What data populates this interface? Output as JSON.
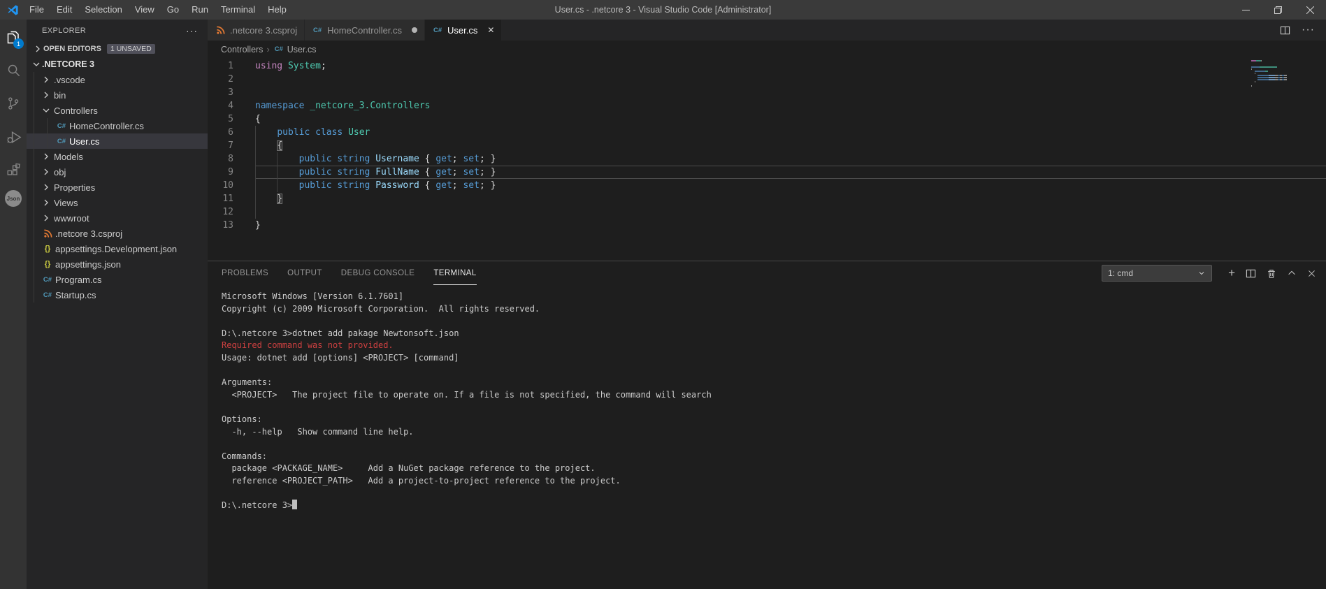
{
  "window": {
    "title": "User.cs - .netcore 3 - Visual Studio Code [Administrator]"
  },
  "menu": {
    "items": [
      "File",
      "Edit",
      "Selection",
      "View",
      "Go",
      "Run",
      "Terminal",
      "Help"
    ]
  },
  "activity_bar": {
    "items": [
      {
        "name": "explorer",
        "badge": "1",
        "active": true
      },
      {
        "name": "search"
      },
      {
        "name": "source-control"
      },
      {
        "name": "run-debug"
      },
      {
        "name": "extensions"
      },
      {
        "name": "json-tool",
        "label": "Json"
      }
    ]
  },
  "sidebar": {
    "title": "EXPLORER",
    "open_editors": {
      "label": "OPEN EDITORS",
      "badge": "1 UNSAVED"
    },
    "root": ".NETCORE 3",
    "tree": [
      {
        "label": ".vscode",
        "kind": "folder",
        "state": "collapsed",
        "level": 1
      },
      {
        "label": "bin",
        "kind": "folder",
        "state": "collapsed",
        "level": 1
      },
      {
        "label": "Controllers",
        "kind": "folder",
        "state": "expanded",
        "level": 1
      },
      {
        "label": "HomeController.cs",
        "kind": "file",
        "icon": "csharp",
        "level": 2
      },
      {
        "label": "User.cs",
        "kind": "file",
        "icon": "csharp",
        "level": 2,
        "selected": true
      },
      {
        "label": "Models",
        "kind": "folder",
        "state": "collapsed",
        "level": 1
      },
      {
        "label": "obj",
        "kind": "folder",
        "state": "collapsed",
        "level": 1
      },
      {
        "label": "Properties",
        "kind": "folder",
        "state": "collapsed",
        "level": 1
      },
      {
        "label": "Views",
        "kind": "folder",
        "state": "collapsed",
        "level": 1
      },
      {
        "label": "wwwroot",
        "kind": "folder",
        "state": "collapsed",
        "level": 1
      },
      {
        "label": ".netcore 3.csproj",
        "kind": "file",
        "icon": "csproj",
        "level": 1
      },
      {
        "label": "appsettings.Development.json",
        "kind": "file",
        "icon": "json",
        "level": 1
      },
      {
        "label": "appsettings.json",
        "kind": "file",
        "icon": "json",
        "level": 1
      },
      {
        "label": "Program.cs",
        "kind": "file",
        "icon": "csharp",
        "level": 1
      },
      {
        "label": "Startup.cs",
        "kind": "file",
        "icon": "csharp",
        "level": 1
      }
    ]
  },
  "tabs": [
    {
      "label": ".netcore 3.csproj",
      "icon": "csproj",
      "active": false,
      "dirty": false
    },
    {
      "label": "HomeController.cs",
      "icon": "csharp",
      "active": false,
      "dirty": true
    },
    {
      "label": "User.cs",
      "icon": "csharp",
      "active": true,
      "dirty": false
    }
  ],
  "breadcrumb": {
    "items": [
      {
        "label": "Controllers"
      },
      {
        "label": "User.cs",
        "icon": "csharp"
      }
    ]
  },
  "editor": {
    "current_line": 9,
    "lines": [
      {
        "tokens": [
          {
            "t": "using ",
            "c": "ctrl"
          },
          {
            "t": "System",
            "c": "type"
          },
          {
            "t": ";",
            "c": "fg"
          }
        ],
        "guides": []
      },
      {
        "tokens": [],
        "guides": []
      },
      {
        "tokens": [],
        "guides": []
      },
      {
        "tokens": [
          {
            "t": "namespace ",
            "c": "kw"
          },
          {
            "t": "_netcore_3.Controllers",
            "c": "type"
          }
        ],
        "guides": []
      },
      {
        "tokens": [
          {
            "t": "{",
            "c": "fg"
          }
        ],
        "guides": []
      },
      {
        "tokens": [
          {
            "t": "    ",
            "c": ""
          },
          {
            "t": "public class ",
            "c": "kw"
          },
          {
            "t": "User",
            "c": "type"
          }
        ],
        "guides": [
          0
        ]
      },
      {
        "tokens": [
          {
            "t": "    ",
            "c": ""
          },
          {
            "t": "{",
            "c": "fg br"
          }
        ],
        "guides": [
          0
        ]
      },
      {
        "tokens": [
          {
            "t": "        ",
            "c": ""
          },
          {
            "t": "public string ",
            "c": "kw"
          },
          {
            "t": "Username",
            "c": "mem"
          },
          {
            "t": " { ",
            "c": "fg"
          },
          {
            "t": "get",
            "c": "kw"
          },
          {
            "t": "; ",
            "c": "fg"
          },
          {
            "t": "set",
            "c": "kw"
          },
          {
            "t": "; }",
            "c": "fg"
          }
        ],
        "guides": [
          0,
          4
        ]
      },
      {
        "tokens": [
          {
            "t": "        ",
            "c": ""
          },
          {
            "t": "public string ",
            "c": "kw"
          },
          {
            "t": "FullName",
            "c": "mem"
          },
          {
            "t": " { ",
            "c": "fg"
          },
          {
            "t": "get",
            "c": "kw"
          },
          {
            "t": "; ",
            "c": "fg"
          },
          {
            "t": "set",
            "c": "kw"
          },
          {
            "t": "; }",
            "c": "fg"
          }
        ],
        "guides": [
          0,
          4
        ]
      },
      {
        "tokens": [
          {
            "t": "        ",
            "c": ""
          },
          {
            "t": "public string ",
            "c": "kw"
          },
          {
            "t": "Password",
            "c": "mem"
          },
          {
            "t": " { ",
            "c": "fg"
          },
          {
            "t": "get",
            "c": "kw"
          },
          {
            "t": "; ",
            "c": "fg"
          },
          {
            "t": "set",
            "c": "kw"
          },
          {
            "t": "; }",
            "c": "fg"
          }
        ],
        "guides": [
          0,
          4
        ]
      },
      {
        "tokens": [
          {
            "t": "    ",
            "c": ""
          },
          {
            "t": "}",
            "c": "fg br"
          }
        ],
        "guides": [
          0
        ]
      },
      {
        "tokens": [],
        "guides": [
          0
        ]
      },
      {
        "tokens": [
          {
            "t": "}",
            "c": "fg"
          }
        ],
        "guides": []
      }
    ]
  },
  "panel": {
    "tabs": [
      {
        "label": "PROBLEMS",
        "active": false
      },
      {
        "label": "OUTPUT",
        "active": false
      },
      {
        "label": "DEBUG CONSOLE",
        "active": false
      },
      {
        "label": "TERMINAL",
        "active": true
      }
    ],
    "terminal_selector": "1: cmd",
    "terminal_lines": [
      {
        "text": "Microsoft Windows [Version 6.1.7601]"
      },
      {
        "text": "Copyright (c) 2009 Microsoft Corporation.  All rights reserved."
      },
      {
        "text": ""
      },
      {
        "text": "D:\\.netcore 3>dotnet add pakage Newtonsoft.json"
      },
      {
        "text": "Required command was not provided.",
        "color": "error"
      },
      {
        "text": "Usage: dotnet add [options] <PROJECT> [command]"
      },
      {
        "text": ""
      },
      {
        "text": "Arguments:"
      },
      {
        "text": "  <PROJECT>   The project file to operate on. If a file is not specified, the command will search"
      },
      {
        "text": ""
      },
      {
        "text": "Options:"
      },
      {
        "text": "  -h, --help   Show command line help."
      },
      {
        "text": ""
      },
      {
        "text": "Commands:"
      },
      {
        "text": "  package <PACKAGE_NAME>     Add a NuGet package reference to the project."
      },
      {
        "text": "  reference <PROJECT_PATH>   Add a project-to-project reference to the project."
      },
      {
        "text": ""
      },
      {
        "text": "D:\\.netcore 3>",
        "cursor": true
      }
    ]
  },
  "colors": {
    "accent": "#007acc",
    "terminal_error": "#cd4040",
    "csharp_icon": "#519aba",
    "csproj_icon": "#e37933",
    "json_icon": "#cbcb41",
    "keyword": "#569cd6",
    "control_keyword": "#c586c0",
    "type_name": "#4ec9b0",
    "member_name": "#9cdcfe"
  }
}
